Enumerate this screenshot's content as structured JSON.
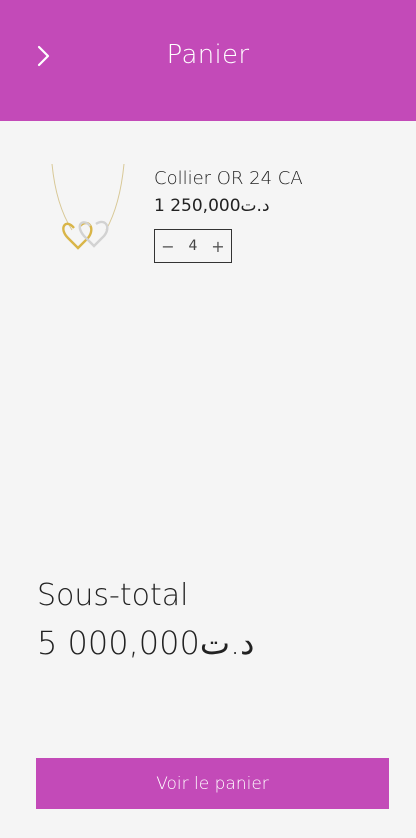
{
  "header": {
    "title": "Panier",
    "back_icon": "chevron-right-icon"
  },
  "cart": {
    "items": [
      {
        "name": "Collier OR 24 CA",
        "price": "1 250,000د.ت",
        "quantity": "4",
        "decrement_symbol": "−",
        "increment_symbol": "+",
        "image": "double-heart-necklace-image"
      }
    ]
  },
  "summary": {
    "subtotal_label": "Sous-total",
    "subtotal_value": "5 000,000د.ت"
  },
  "actions": {
    "view_cart_label": "Voir le panier"
  },
  "colors": {
    "accent": "#c34ab8",
    "background": "#f5f5f5"
  }
}
